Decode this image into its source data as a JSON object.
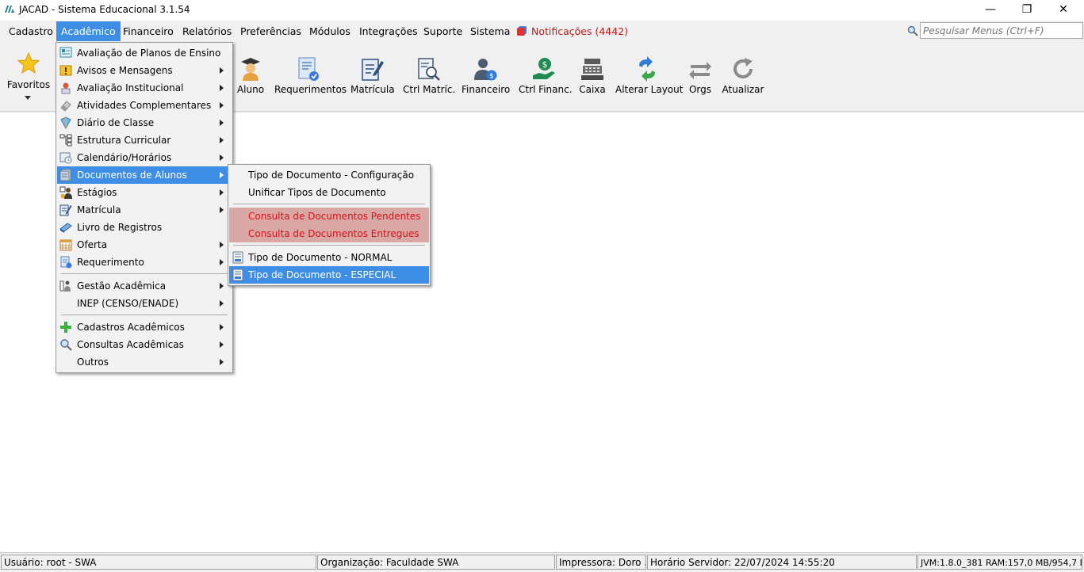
{
  "window": {
    "title": "JACAD - Sistema Educacional 3.1.54",
    "minimize": "—",
    "maximize": "❐",
    "close": "✕"
  },
  "menubar": {
    "items": [
      "Cadastro",
      "Acadêmico",
      "Financeiro",
      "Relatórios",
      "Preferências",
      "Módulos",
      "Integrações",
      "Suporte",
      "Sistema"
    ],
    "active": "Acadêmico",
    "notifications": "Notificações (4442)",
    "search_placeholder": "Pesquisar Menus (Ctrl+F)"
  },
  "toolbar": {
    "favorites": "Favoritos",
    "buttons": [
      "Aluno",
      "Requerimentos",
      "Matrícula",
      "Ctrl Matríc.",
      "Financeiro",
      "Ctrl Financ.",
      "Caixa",
      "Alterar Layout",
      "Orgs",
      "Atualizar"
    ]
  },
  "academico_menu": {
    "items": [
      "Avaliação de Planos de Ensino",
      "Avisos e Mensagens",
      "Avaliação Institucional",
      "Atividades Complementares",
      "Diário de Classe",
      "Estrutura Curricular",
      "Calendário/Horários",
      "Documentos de Alunos",
      "Estágios",
      "Matrícula",
      "Livro de Registros",
      "Oferta",
      "Requerimento",
      "Gestão Acadêmica",
      "INEP (CENSO/ENADE)",
      "Cadastros Acadêmicos",
      "Consultas Acadêmicas",
      "Outros"
    ],
    "selected": "Documentos de Alunos"
  },
  "documentos_submenu": {
    "items": [
      "Tipo de Documento - Configuração",
      "Unificar Tipos de Documento",
      "Consulta de Documentos Pendentes",
      "Consulta de Documentos Entregues",
      "Tipo de Documento - NORMAL",
      "Tipo de Documento - ESPECIAL"
    ],
    "selected": "Tipo de Documento - ESPECIAL",
    "warn_color": "#d9101a"
  },
  "statusbar": {
    "user": "Usuário: root - SWA",
    "organization": "Organização: Faculdade SWA",
    "printer": "Impressora: Doro ...",
    "server_time": "Horário Servidor: 22/07/2024 14:55:20",
    "jvm": "JVM:1.8.0_381  RAM:157,0 MB/954,7 MB"
  },
  "colors": {
    "selection": "#3f8ee5",
    "notification": "#c01818",
    "warn_bg": "#d9a7a4"
  }
}
